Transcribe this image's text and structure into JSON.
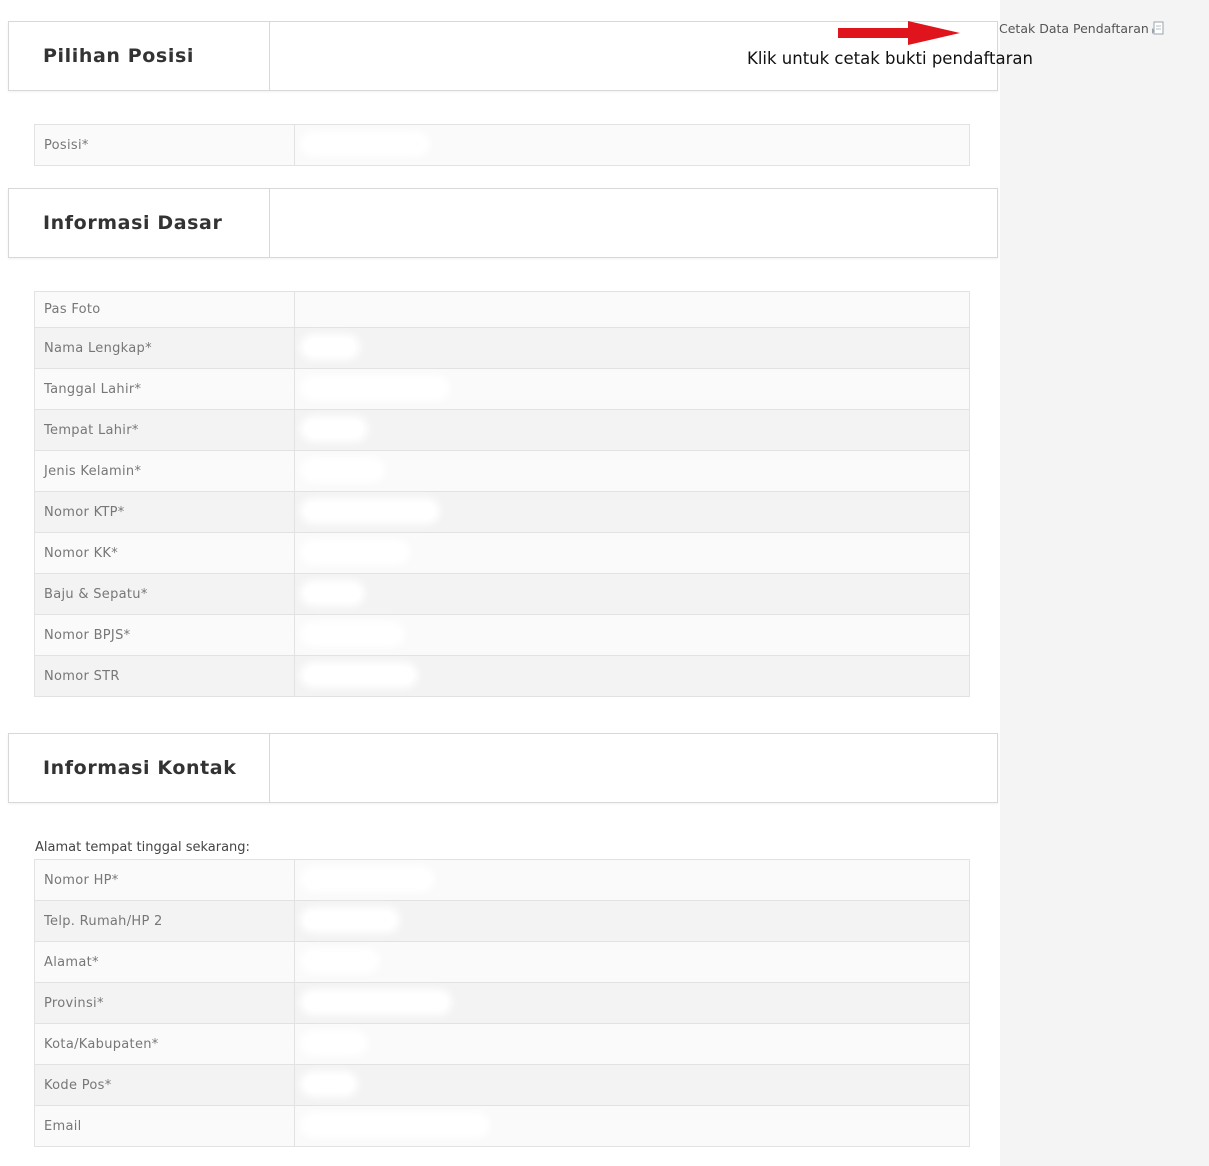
{
  "print_link": {
    "label": "Cetak Data Pendaftaran",
    "icon": "print-icon"
  },
  "annotation": {
    "text": "Klik untuk cetak bukti pendaftaran",
    "arrow_color": "#e0141c"
  },
  "sections": {
    "posisi": {
      "title": "Pilihan Posisi"
    },
    "dasar": {
      "title": "Informasi Dasar"
    },
    "kontak": {
      "title": "Informasi Kontak",
      "caption": "Alamat tempat tinggal sekarang:"
    }
  },
  "fields": {
    "posisi": [
      "Posisi*"
    ],
    "dasar": [
      "Pas Foto",
      "Nama Lengkap*",
      "Tanggal Lahir*",
      "Tempat Lahir*",
      "Jenis Kelamin*",
      "Nomor KTP*",
      "Nomor KK*",
      "Baju & Sepatu*",
      "Nomor BPJS*",
      "Nomor STR"
    ],
    "kontak": [
      "Nomor HP*",
      "Telp. Rumah/HP 2",
      "Alamat*",
      "Provinsi*",
      "Kota/Kabupaten*",
      "Kode Pos*",
      "Email"
    ]
  }
}
